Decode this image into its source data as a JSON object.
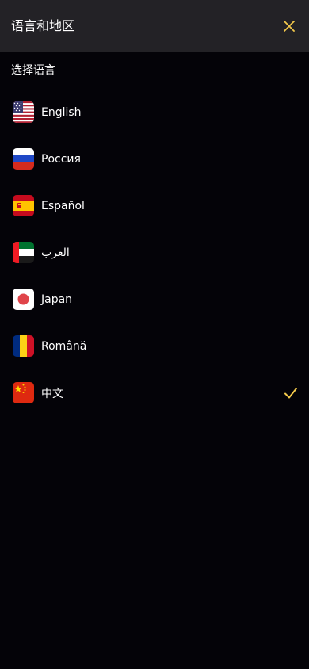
{
  "header": {
    "title": "语言和地区",
    "close_icon": "close-icon"
  },
  "section": {
    "label": "选择语言"
  },
  "languages": [
    {
      "label": "English",
      "flag": "us-flag-icon",
      "selected": false
    },
    {
      "label": "Россия",
      "flag": "russia-flag-icon",
      "selected": false
    },
    {
      "label": "Español",
      "flag": "spain-flag-icon",
      "selected": false
    },
    {
      "label": "العرب",
      "flag": "uae-flag-icon",
      "selected": false
    },
    {
      "label": "Japan",
      "flag": "japan-flag-icon",
      "selected": false
    },
    {
      "label": "Română",
      "flag": "romania-flag-icon",
      "selected": false
    },
    {
      "label": "中文",
      "flag": "china-flag-icon",
      "selected": true
    }
  ],
  "colors": {
    "accent": "#f2c84b",
    "header_bg": "#232226",
    "page_bg": "#040308"
  }
}
